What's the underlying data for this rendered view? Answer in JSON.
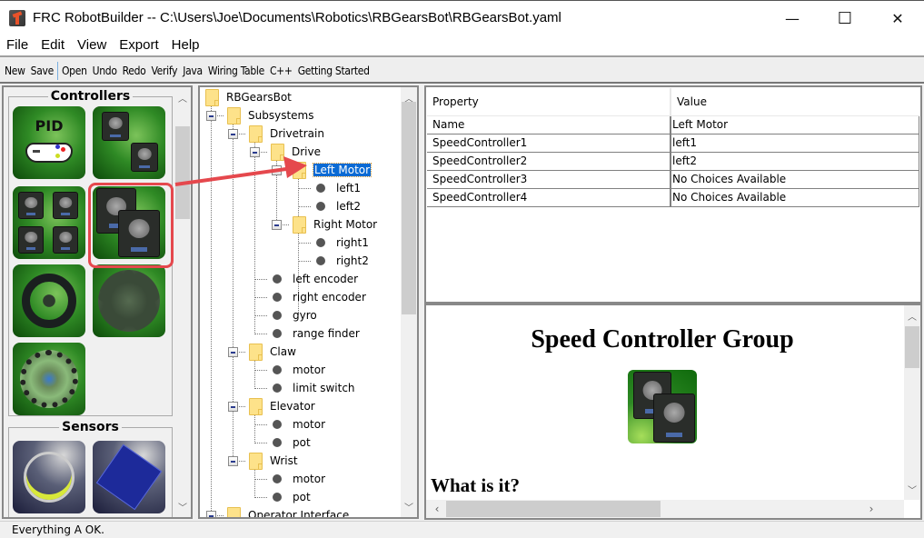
{
  "window": {
    "title": "FRC RobotBuilder -- C:\\Users\\Joe\\Documents\\Robotics\\RBGearsBot\\RBGearsBot.yaml",
    "controls": {
      "minimize": "—",
      "maximize": "☐",
      "close": "✕"
    }
  },
  "menu": [
    "File",
    "Edit",
    "View",
    "Export",
    "Help"
  ],
  "toolbar": [
    "New",
    "Save",
    "Open",
    "Undo",
    "Redo",
    "Verify",
    "Java",
    "Wiring Table",
    "C++",
    "Getting Started"
  ],
  "palette": {
    "groups": [
      {
        "title": "Controllers",
        "items": [
          {
            "name": "PID Controller",
            "icon": "pid-gamepad-icon",
            "pid_label": "PID"
          },
          {
            "name": "Speed Controller Group (2)",
            "icon": "two-speed-controllers-icon"
          },
          {
            "name": "Four Speed Controllers",
            "icon": "four-speed-controllers-icon"
          },
          {
            "name": "Speed Controller Group",
            "icon": "speed-controller-group-icon",
            "selected": true
          },
          {
            "name": "Wheel",
            "icon": "wheel-icon"
          },
          {
            "name": "Mecanum Wheel",
            "icon": "mecanum-wheel-icon"
          },
          {
            "name": "Omni Wheel",
            "icon": "omni-wheel-icon"
          }
        ]
      },
      {
        "title": "Sensors",
        "items": [
          {
            "name": "Gyro",
            "icon": "gyro-icon"
          },
          {
            "name": "Accelerometer",
            "icon": "accelerometer-board-icon"
          }
        ]
      }
    ]
  },
  "tree": {
    "root": "RBGearsBot",
    "nodes": [
      {
        "label": "RBGearsBot",
        "type": "folder",
        "depth": 0
      },
      {
        "label": "Subsystems",
        "type": "folder",
        "depth": 1,
        "expanded": true
      },
      {
        "label": "Drivetrain",
        "type": "folder",
        "depth": 2,
        "expanded": true
      },
      {
        "label": "Drive",
        "type": "folder",
        "depth": 3,
        "expanded": true
      },
      {
        "label": "Left Motor",
        "type": "folder",
        "depth": 4,
        "expanded": true,
        "selected": true
      },
      {
        "label": "left1",
        "type": "leaf",
        "depth": 5
      },
      {
        "label": "left2",
        "type": "leaf",
        "depth": 5
      },
      {
        "label": "Right Motor",
        "type": "folder",
        "depth": 4,
        "expanded": true
      },
      {
        "label": "right1",
        "type": "leaf",
        "depth": 5
      },
      {
        "label": "right2",
        "type": "leaf",
        "depth": 5
      },
      {
        "label": "left encoder",
        "type": "leaf",
        "depth": 3
      },
      {
        "label": "right encoder",
        "type": "leaf",
        "depth": 3
      },
      {
        "label": "gyro",
        "type": "leaf",
        "depth": 3
      },
      {
        "label": "range finder",
        "type": "leaf",
        "depth": 3
      },
      {
        "label": "Claw",
        "type": "folder",
        "depth": 2,
        "expanded": true
      },
      {
        "label": "motor",
        "type": "leaf",
        "depth": 3
      },
      {
        "label": "limit switch",
        "type": "leaf",
        "depth": 3
      },
      {
        "label": "Elevator",
        "type": "folder",
        "depth": 2,
        "expanded": true
      },
      {
        "label": "motor",
        "type": "leaf",
        "depth": 3
      },
      {
        "label": "pot",
        "type": "leaf",
        "depth": 3
      },
      {
        "label": "Wrist",
        "type": "folder",
        "depth": 2,
        "expanded": true
      },
      {
        "label": "motor",
        "type": "leaf",
        "depth": 3
      },
      {
        "label": "pot",
        "type": "leaf",
        "depth": 3
      },
      {
        "label": "Operator Interface",
        "type": "folder",
        "depth": 1,
        "expanded": true
      }
    ]
  },
  "properties": {
    "headers": [
      "Property",
      "Value"
    ],
    "rows": [
      [
        "Name",
        "Left Motor"
      ],
      [
        "SpeedController1",
        "left1"
      ],
      [
        "SpeedController2",
        "left2"
      ],
      [
        "SpeedController3",
        "No Choices Available"
      ],
      [
        "SpeedController4",
        "No Choices Available"
      ]
    ]
  },
  "help": {
    "title": "Speed Controller Group",
    "subtitle": "What is it?",
    "image": "speed-controller-group-icon"
  },
  "status": "Everything A OK.",
  "annotation": {
    "color": "#e5484d",
    "from": "palette-speed-controller-group",
    "to": "tree-left-motor"
  }
}
